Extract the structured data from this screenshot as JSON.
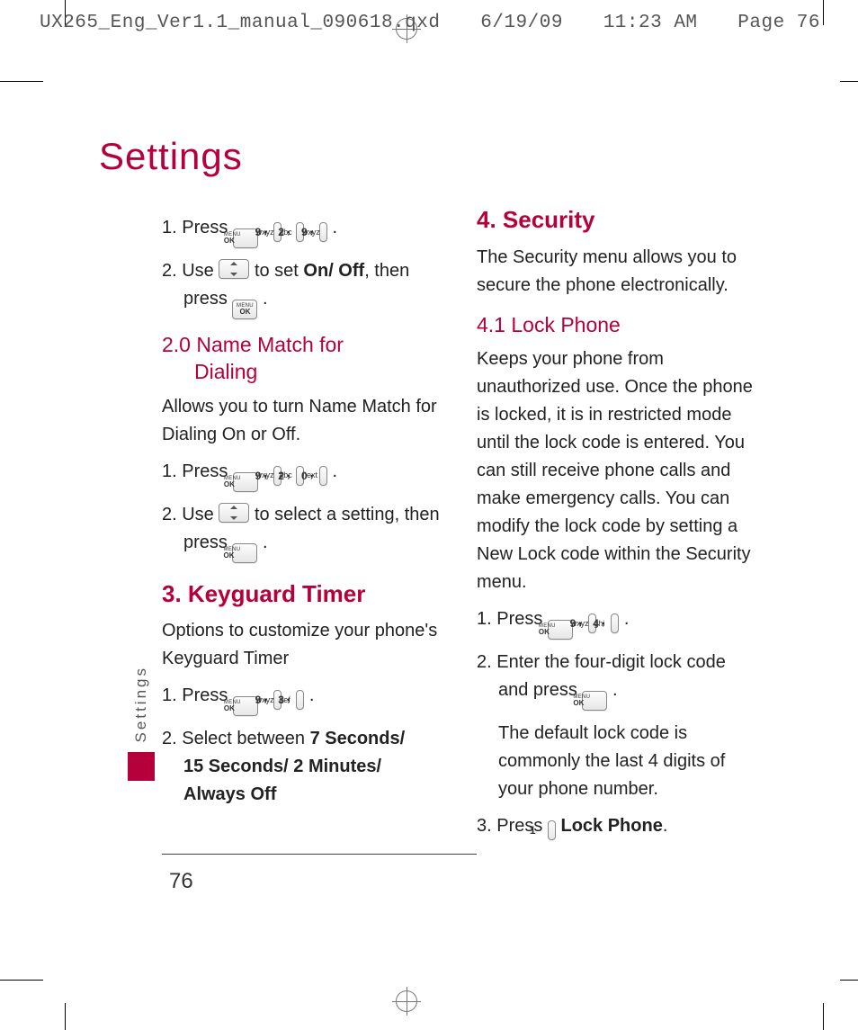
{
  "prepress": {
    "filename": "UX265_Eng_Ver1.1_manual_090618.qxd",
    "date": "6/19/09",
    "time": "11:23 AM",
    "page_label": "Page 76"
  },
  "page_title": "Settings",
  "side_tab": "Settings",
  "page_number": "76",
  "left": {
    "step1": "1. Press",
    "step2a": "2. Use",
    "step2b": "to set",
    "on_off": "On/ Off",
    "step2c": ", then",
    "step2d": "press",
    "h3a_line1": "2.0 Name Match for",
    "h3a_line2": "Dialing",
    "p1": "Allows you to turn Name Match for Dialing On or Off.",
    "step1b": "1. Press",
    "step2e": "2. Use",
    "step2f": "to select a setting, then press",
    "h2a": "3. Keyguard Timer",
    "p2": "Options to customize your phone's Keyguard Timer",
    "step1c": "1. Press",
    "step2g": "2. Select between",
    "opts1": "7 Seconds/",
    "opts2": "15 Seconds/ 2 Minutes/",
    "opts3": "Always Off"
  },
  "right": {
    "h2": "4. Security",
    "p1": "The Security menu allows you to secure the phone electronically.",
    "h3": "4.1 Lock Phone",
    "p2": "Keeps your phone from unauthorized use. Once the phone is locked, it is in restricted mode until the lock code is entered. You can still receive phone calls and make emergency calls. You can modify the lock code by setting a New Lock code within the Security menu.",
    "step1": "1. Press",
    "step2a": "2. Enter the four-digit lock code and press",
    "step2b": "The default lock code is commonly the last 4 digits of your phone number.",
    "step3a": "3. Press",
    "step3b": "Lock Phone"
  },
  "keys": {
    "ok_menu": "MENU",
    "ok_ok": "OK",
    "k9": "9",
    "k9s": "wxyz",
    "k2": "2",
    "k2s": "abc",
    "k0": "0",
    "k0s": "next",
    "k3": "3",
    "k3s": "def",
    "k4": "4",
    "k4s": "ghi",
    "k1": "1",
    "k1s": ""
  }
}
